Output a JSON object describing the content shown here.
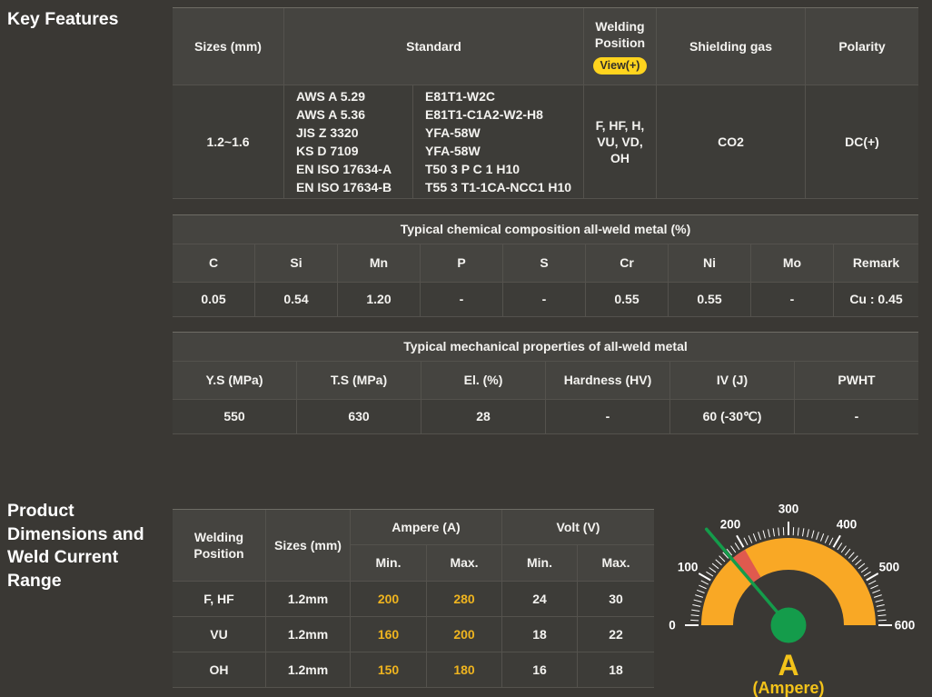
{
  "page": {
    "section1_title": "Key Features",
    "section2_title": "Product Dimensions and Weld Current Range"
  },
  "spec_table": {
    "headers": {
      "sizes": "Sizes (mm)",
      "standard": "Standard",
      "welding_position": "Welding Position",
      "view_badge": "View(+)",
      "shielding_gas": "Shielding gas",
      "polarity": "Polarity"
    },
    "row": {
      "sizes": "1.2~1.6",
      "standard_specs": [
        "AWS A 5.29",
        "AWS A 5.36",
        "JIS Z 3320",
        "KS D 7109",
        "EN ISO 17634-A",
        "EN ISO 17634-B"
      ],
      "standard_classes": [
        "E81T1-W2C",
        "E81T1-C1A2-W2-H8",
        "YFA-58W",
        "YFA-58W",
        "T50 3 P C 1 H10",
        "T55 3 T1-1CA-NCC1 H10"
      ],
      "welding_position": "F, HF, H, VU, VD, OH",
      "shielding_gas": "CO2",
      "polarity": "DC(+)"
    }
  },
  "chem_table": {
    "caption": "Typical chemical composition all-weld metal (%)",
    "headers": [
      "C",
      "Si",
      "Mn",
      "P",
      "S",
      "Cr",
      "Ni",
      "Mo",
      "Remark"
    ],
    "values": [
      "0.05",
      "0.54",
      "1.20",
      "-",
      "-",
      "0.55",
      "0.55",
      "-",
      "Cu : 0.45"
    ]
  },
  "mech_table": {
    "caption": "Typical mechanical properties of all-weld metal",
    "headers": [
      "Y.S (MPa)",
      "T.S (MPa)",
      "El. (%)",
      "Hardness (HV)",
      "IV (J)",
      "PWHT"
    ],
    "values": [
      "550",
      "630",
      "28",
      "-",
      "60 (-30℃)",
      "-"
    ]
  },
  "current_table": {
    "headers": {
      "welding_position": "Welding Position",
      "sizes": "Sizes (mm)",
      "ampere": "Ampere (A)",
      "volt": "Volt (V)",
      "min": "Min.",
      "max": "Max."
    },
    "rows": [
      {
        "position": "F, HF",
        "size": "1.2mm",
        "a_min": "200",
        "a_max": "280",
        "v_min": "24",
        "v_max": "30"
      },
      {
        "position": "VU",
        "size": "1.2mm",
        "a_min": "160",
        "a_max": "200",
        "v_min": "18",
        "v_max": "22"
      },
      {
        "position": "OH",
        "size": "1.2mm",
        "a_min": "150",
        "a_max": "180",
        "v_min": "16",
        "v_max": "18"
      }
    ]
  },
  "gauge": {
    "type": "gauge",
    "min": 0,
    "max": 600,
    "tick_step": 10,
    "label_step": 100,
    "tick_labels": [
      "0",
      "100",
      "200",
      "300",
      "400",
      "500",
      "600"
    ],
    "needle_value": 165,
    "band": {
      "from": 165,
      "to": 200
    },
    "unit": "A",
    "unit_caption": "(Ampere)",
    "colors": {
      "arc": "#f9a825",
      "band": "#e05a4e",
      "needle": "#149c4b",
      "hub": "#149c4b",
      "tick": "#ffffff",
      "label": "#ffffff",
      "unit": "#f3c31a"
    }
  }
}
